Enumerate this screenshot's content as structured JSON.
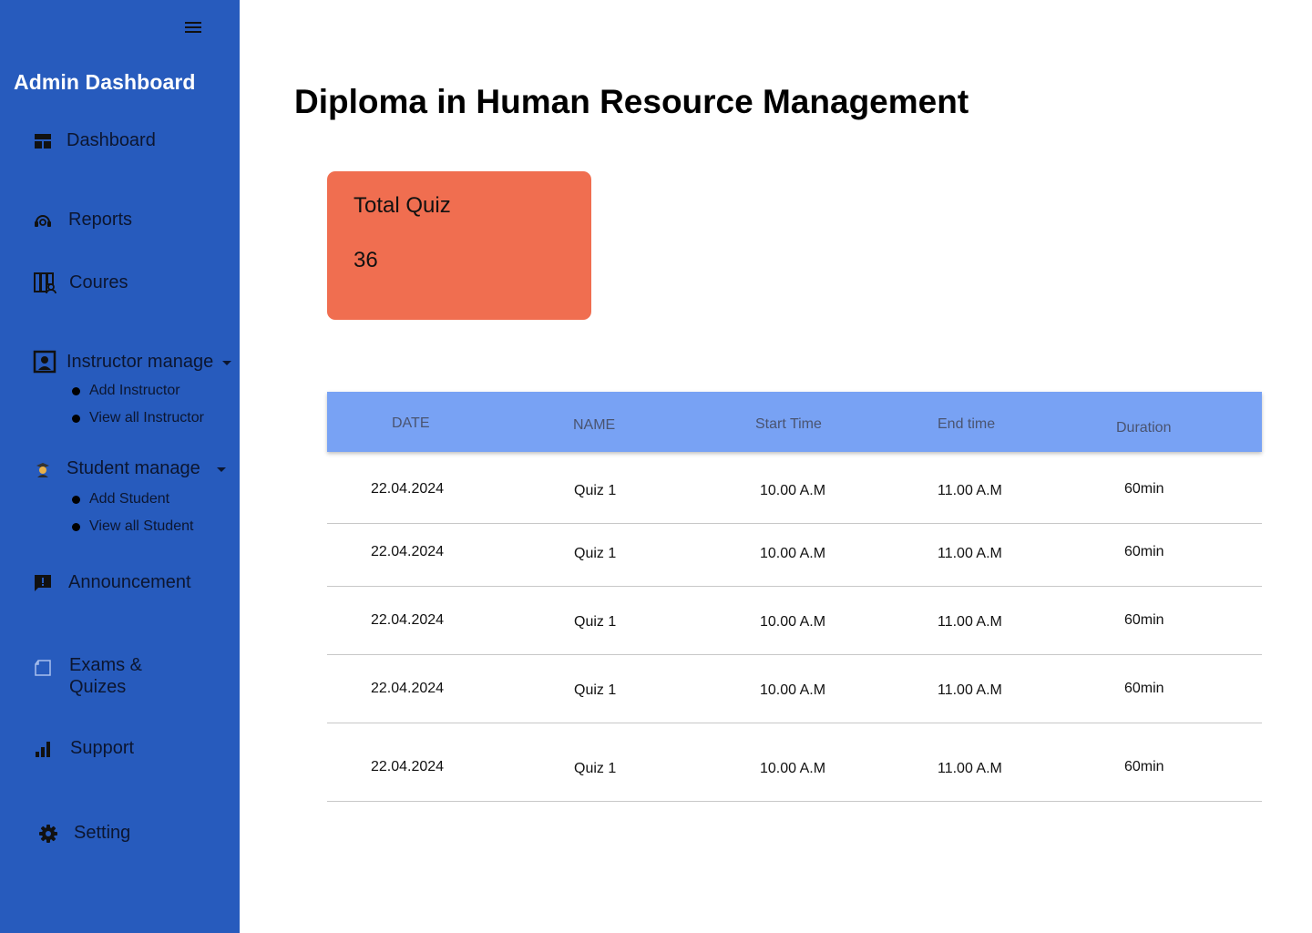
{
  "sidebar": {
    "app_title": "Admin Dashboard",
    "items": {
      "dashboard": "Dashboard",
      "reports": "Reports",
      "courses": "Coures",
      "instructor_manage": "Instructor manage",
      "student_manage": "Student manage",
      "announcement": "Announcement",
      "exams_line1": "Exams &",
      "exams_line2": "Quizes",
      "support": "Support",
      "setting": "Setting"
    },
    "instructor_sub": [
      "Add Instructor",
      "View all Instructor"
    ],
    "student_sub": [
      "Add Student",
      "View all Student"
    ]
  },
  "main": {
    "title": "Diploma in Human Resource Management",
    "stat": {
      "label": "Total Quiz",
      "value": "36"
    },
    "table": {
      "headers": [
        "DATE",
        "NAME",
        "Start Time",
        "End time",
        "Duration"
      ],
      "rows": [
        [
          "22.04.2024",
          "Quiz 1",
          "10.00 A.M",
          "11.00 A.M",
          "60min"
        ],
        [
          "22.04.2024",
          "Quiz 1",
          "10.00 A.M",
          "11.00 A.M",
          "60min"
        ],
        [
          "22.04.2024",
          "Quiz 1",
          "10.00 A.M",
          "11.00 A.M",
          "60min"
        ],
        [
          "22.04.2024",
          "Quiz 1",
          "10.00 A.M",
          "11.00 A.M",
          "60min"
        ],
        [
          "22.04.2024",
          "Quiz 1",
          "10.00 A.M",
          "11.00 A.M",
          "60min"
        ]
      ]
    }
  },
  "colors": {
    "sidebar_bg": "#275bbd",
    "stat_card_bg": "#f06e50",
    "table_header_bg": "#78a2f4"
  },
  "icons": [
    "hamburger-menu-icon",
    "dashboard-icon",
    "reports-icon",
    "courses-icon",
    "instructor-icon",
    "student-icon",
    "announcement-icon",
    "exams-icon",
    "support-icon",
    "settings-gear-icon"
  ]
}
